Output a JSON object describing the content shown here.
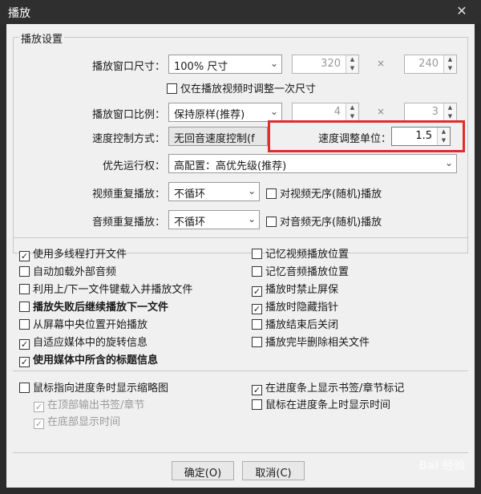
{
  "window": {
    "title": "播放",
    "close_glyph": "✕"
  },
  "group_title": "播放设置",
  "size": {
    "label": "播放窗口尺寸：",
    "value": "100% 尺寸",
    "width": "320",
    "height": "240",
    "times": "×"
  },
  "only_once": {
    "label": "仅在播放视频时调整一次尺寸",
    "checked": false
  },
  "ratio": {
    "label": "播放窗口比例：",
    "value": "保持原样(推荐)",
    "w": "4",
    "h": "3",
    "times": "×"
  },
  "speed": {
    "label": "速度控制方式：",
    "value": "无回音速度控制(f",
    "unit_label": "速度调整单位：",
    "unit_value": "1.5"
  },
  "priority": {
    "label": "优先运行权：",
    "value": "高配置：高优先级(推荐)"
  },
  "video_repeat": {
    "label": "视频重复播放：",
    "value": "不循环",
    "random_label": "对视频无序(随机)播放",
    "random_checked": false
  },
  "audio_repeat": {
    "label": "音频重复播放：",
    "value": "不循环",
    "random_label": "对音频无序(随机)播放",
    "random_checked": false
  },
  "left_options": [
    {
      "label": "使用多线程打开文件",
      "checked": true,
      "bold": false
    },
    {
      "label": "自动加载外部音频",
      "checked": false,
      "bold": false
    },
    {
      "label": "利用上/下一文件键载入并播放文件",
      "checked": false,
      "bold": false
    },
    {
      "label": "播放失败后继续播放下一文件",
      "checked": false,
      "bold": true
    },
    {
      "label": "从屏幕中央位置开始播放",
      "checked": false,
      "bold": false
    },
    {
      "label": "自适应媒体中的旋转信息",
      "checked": true,
      "bold": false
    },
    {
      "label": "使用媒体中所含的标题信息",
      "checked": true,
      "bold": true
    }
  ],
  "right_options": [
    {
      "label": "记忆视频播放位置",
      "checked": false
    },
    {
      "label": "记忆音频播放位置",
      "checked": false
    },
    {
      "label": "播放时禁止屏保",
      "checked": true
    },
    {
      "label": "播放时隐藏指针",
      "checked": true
    },
    {
      "label": "播放结束后关闭",
      "checked": false
    },
    {
      "label": "播放完毕删除相关文件",
      "checked": false
    }
  ],
  "thumb": {
    "label": "鼠标指向进度条时显示缩略图",
    "checked": false
  },
  "thumb_sub": [
    {
      "label": "在顶部输出书签/章节",
      "checked": true
    },
    {
      "label": "在底部显示时间",
      "checked": true
    }
  ],
  "seek_right": [
    {
      "label": "在进度条上显示书签/章节标记",
      "checked": true
    },
    {
      "label": "鼠标在进度条上时显示时间",
      "checked": false
    }
  ],
  "buttons": {
    "ok": "确定(O)",
    "cancel": "取消(C)"
  },
  "watermark": "Bai 经验",
  "check_glyph": "✓",
  "arrow_glyph": "⌄",
  "highlight_color": "#e32b2b"
}
